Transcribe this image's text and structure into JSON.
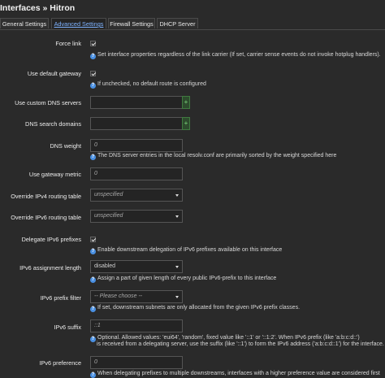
{
  "page": {
    "title": "Interfaces » Hitron"
  },
  "tabs": [
    {
      "label": "General Settings"
    },
    {
      "label": "Advanced Settings"
    },
    {
      "label": "Firewall Settings"
    },
    {
      "label": "DHCP Server"
    }
  ],
  "fields": {
    "force_link": {
      "label": "Force link",
      "checked": true,
      "help": "Set interface properties regardless of the link carrier (If set, carrier sense events do not invoke hotplug handlers)."
    },
    "use_default_gateway": {
      "label": "Use default gateway",
      "checked": true,
      "help": "If unchecked, no default route is configured"
    },
    "use_custom_dns": {
      "label": "Use custom DNS servers",
      "value": ""
    },
    "dns_search_domains": {
      "label": "DNS search domains",
      "value": ""
    },
    "dns_weight": {
      "label": "DNS weight",
      "placeholder": "0",
      "help": "The DNS server entries in the local resolv.conf are primarily sorted by the weight specified here"
    },
    "gateway_metric": {
      "label": "Use gateway metric",
      "placeholder": "0"
    },
    "ipv4_routing_table": {
      "label": "Override IPv4 routing table",
      "value": "unspecified"
    },
    "ipv6_routing_table": {
      "label": "Override IPv6 routing table",
      "value": "unspecified"
    },
    "delegate_ipv6": {
      "label": "Delegate IPv6 prefixes",
      "checked": true,
      "help": "Enable downstream delegation of IPv6 prefixes available on this interface"
    },
    "ipv6_assignment_length": {
      "label": "IPv6 assignment length",
      "value": "disabled",
      "help": "Assign a part of given length of every public IPv6-prefix to this interface"
    },
    "ipv6_prefix_filter": {
      "label": "IPv6 prefix filter",
      "value": "-- Please choose --",
      "help": "If set, downstream subnets are only allocated from the given IPv6 prefix classes."
    },
    "ipv6_suffix": {
      "label": "IPv6 suffix",
      "placeholder": "::1",
      "help_line1": "Optional. Allowed values: 'eui64', 'random', fixed value like '::1' or '::1:2'. When IPv6 prefix (like 'a:b:c:d::')",
      "help_line2": "is received from a delegating server, use the suffix (like '::1') to form the IPv6 address ('a:b:c:d::1') for the interface."
    },
    "ipv6_preference": {
      "label": "IPv6 preference",
      "placeholder": "0",
      "help": "When delegating prefixes to multiple downstreams, interfaces with a higher preference value are considered first"
    }
  },
  "icons": {
    "help": "help-icon",
    "add": "+"
  },
  "colors": {
    "accent": "#4a90e2",
    "active_tab": "#7fb3ff",
    "add_button": "#7fda7f"
  }
}
